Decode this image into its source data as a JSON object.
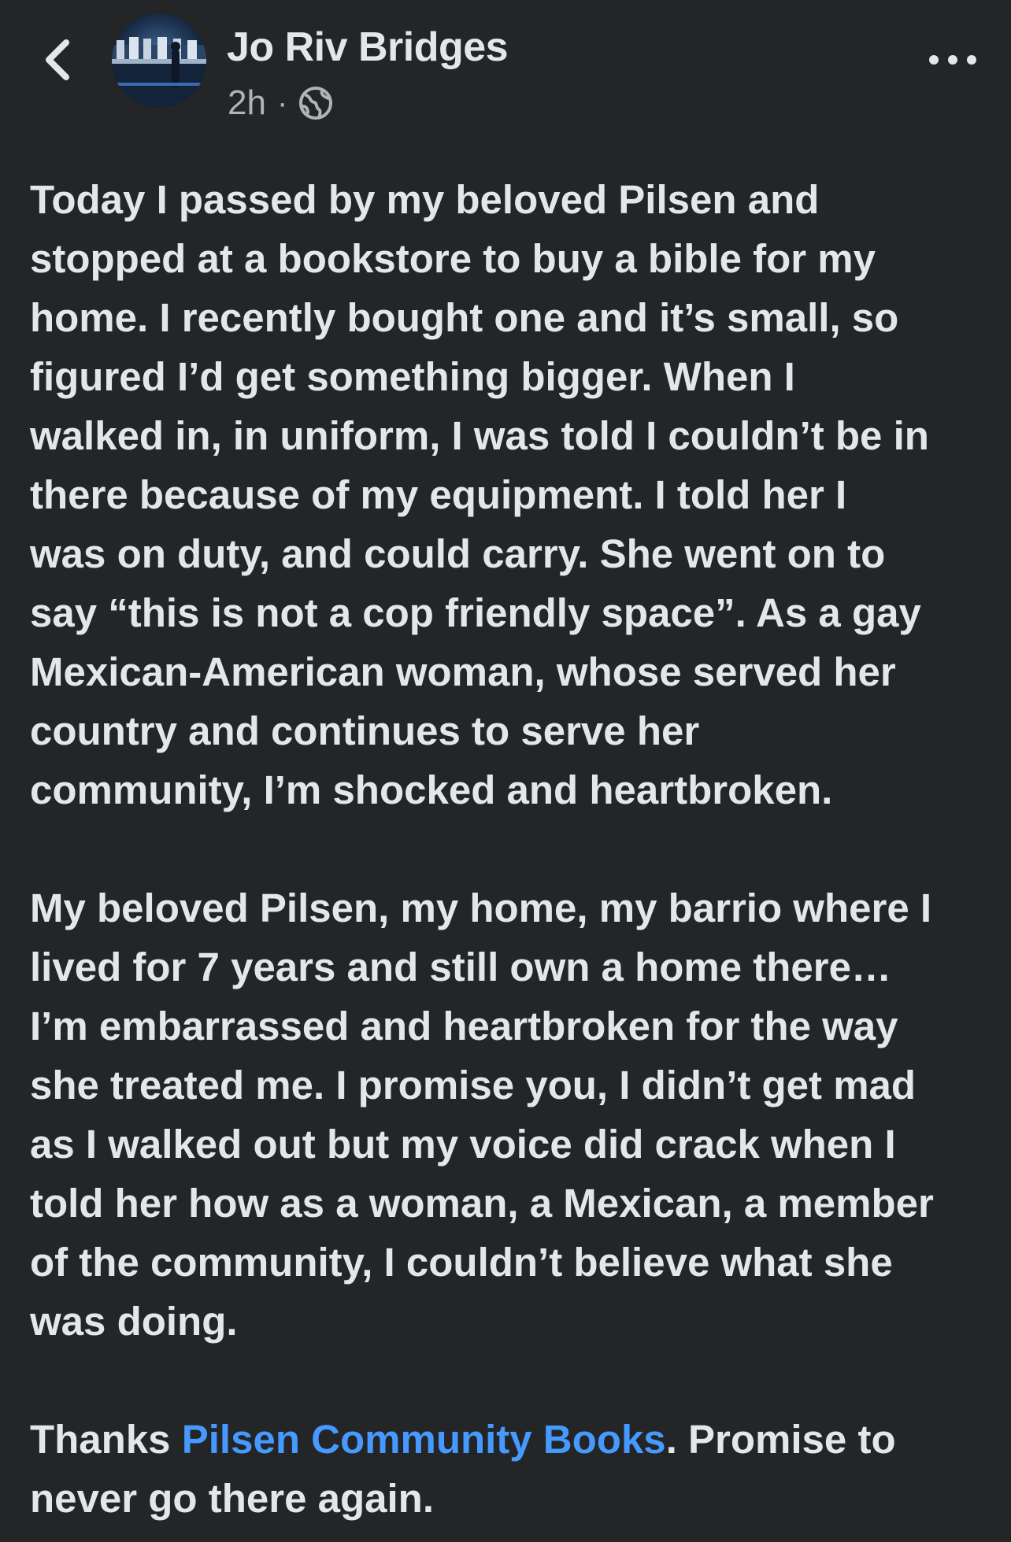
{
  "header": {
    "back_icon": "chevron-left-icon",
    "avatar_icon": "profile-photo",
    "author_name": "Jo Riv Bridges",
    "time": "2h",
    "separator": "·",
    "privacy_icon": "globe-icon",
    "more_icon": "more-horizontal-icon"
  },
  "post": {
    "paragraph1": "Today I passed by my beloved Pilsen and\nstopped at a bookstore to buy a bible for my\nhome. I recently bought one and it’s small, so\nfigured I’d get something bigger. When I\nwalked in, in uniform, I was told I couldn’t be in\nthere because of my equipment. I told her I\nwas on duty, and could carry. She went on to\nsay “this is not a cop friendly space”.  As a gay\nMexican-American woman, whose served her\ncountry and continues to serve her\ncommunity, I’m shocked and heartbroken.",
    "paragraph2": "My beloved Pilsen, my home, my barrio where I\nlived for 7 years and still own a home there…\nI’m embarrassed and heartbroken for the way\nshe treated me. I promise you, I didn’t get mad\nas I walked out but my voice did crack when I\ntold her how as a woman, a Mexican, a member\nof the community, I couldn’t believe what she\nwas doing.",
    "paragraph3_prefix": "Thanks ",
    "paragraph3_link": "Pilsen Community Books",
    "paragraph3_line1_suffix": ".  Promise to",
    "paragraph3_line2": "never go there again."
  },
  "colors": {
    "background": "#242526",
    "text": "#e4e6eb",
    "secondary_text": "#b0b3b8",
    "link": "#4599ff"
  }
}
